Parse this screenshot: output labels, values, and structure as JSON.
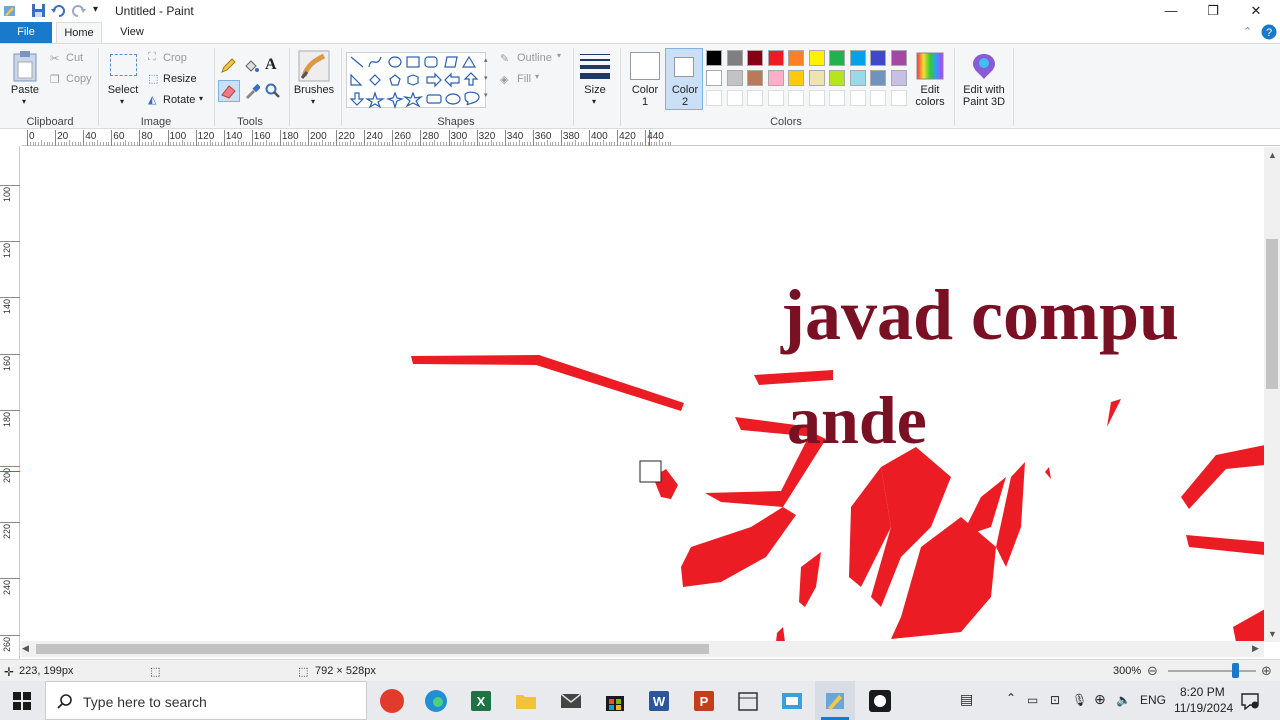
{
  "window": {
    "title": "Untitled - Paint",
    "minimize_glyph": "—",
    "restore_glyph": "❐",
    "close_glyph": "✕"
  },
  "tabs": {
    "file": "File",
    "home": "Home",
    "view": "View"
  },
  "ribbon": {
    "clipboard": {
      "label": "Clipboard",
      "paste": "Paste",
      "cut": "Cut",
      "copy": "Copy"
    },
    "image": {
      "label": "Image",
      "select": "Select",
      "crop": "Crop",
      "resize": "Resize",
      "rotate": "Rotate"
    },
    "tools": {
      "label": "Tools",
      "text_glyph": "A"
    },
    "brushes": {
      "label": "Brushes"
    },
    "shapes": {
      "label": "Shapes",
      "outline": "Outline",
      "fill": "Fill"
    },
    "size": {
      "label": "Size"
    },
    "colors": {
      "label": "Colors",
      "color1": "Color 1",
      "color1_line1": "Color",
      "color1_line2": "1",
      "color2_line1": "Color",
      "color2_line2": "2",
      "edit_colors_line1": "Edit",
      "edit_colors_line2": "colors",
      "paint3d_line1": "Edit with",
      "paint3d_line2": "Paint 3D",
      "palette_row1": [
        "#000000",
        "#7f7f7f",
        "#880015",
        "#ed1c24",
        "#ff7f27",
        "#fff200",
        "#22b14c",
        "#00a2e8",
        "#3f48cc",
        "#a349a4"
      ],
      "palette_row2": [
        "#ffffff",
        "#c3c3c3",
        "#b97a57",
        "#ffaec9",
        "#ffc90e",
        "#efe4b0",
        "#b5e61d",
        "#99d9ea",
        "#7092be",
        "#c8bfe7"
      ]
    }
  },
  "rulers": {
    "horizontal": [
      "0",
      "20",
      "40",
      "60",
      "80",
      "100",
      "120",
      "140",
      "160",
      "180",
      "200",
      "220",
      "240",
      "260",
      "280",
      "300",
      "320",
      "340",
      "360",
      "380",
      "400",
      "420",
      "440"
    ],
    "vertical": [
      "100",
      "120",
      "140",
      "160",
      "180",
      "200",
      "220",
      "240",
      "260"
    ]
  },
  "canvas": {
    "text_line1": "javad compu",
    "text_line2": "ande"
  },
  "statusbar": {
    "cursor_pos": "223, 199px",
    "image_size": "792 × 528px",
    "zoom": "300%"
  },
  "taskbar": {
    "search_placeholder": "Type here to search",
    "language": "ENG",
    "time": "8:20 PM",
    "date": "11/19/2024"
  }
}
